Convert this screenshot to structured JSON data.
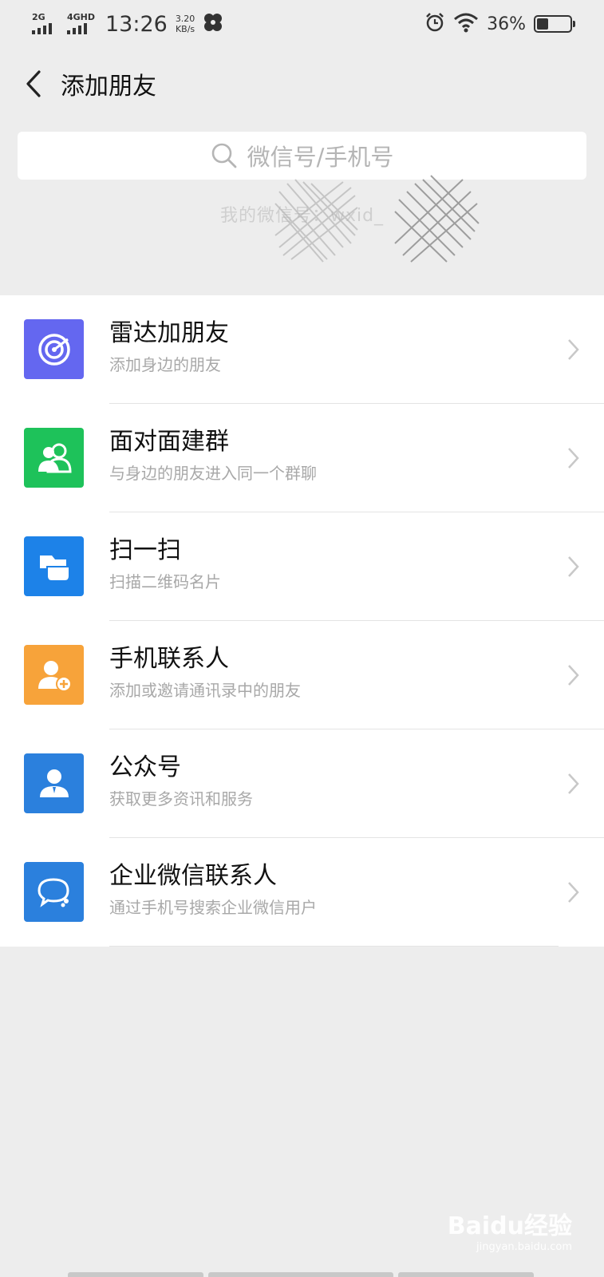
{
  "status_bar": {
    "net1": "2G",
    "net2": "4GHD",
    "time": "13:26",
    "speed_value": "3.20",
    "speed_unit": "KB/s",
    "battery_pct": "36%",
    "battery_level": 0.36
  },
  "header": {
    "title": "添加朋友"
  },
  "search": {
    "placeholder": "微信号/手机号"
  },
  "my_id": {
    "text": "我的微信号：wxid_"
  },
  "items": [
    {
      "title": "雷达加朋友",
      "subtitle": "添加身边的朋友",
      "icon": "radar-icon",
      "color": "#6467f0"
    },
    {
      "title": "面对面建群",
      "subtitle": "与身边的朋友进入同一个群聊",
      "icon": "group-icon",
      "color": "#1ec25a"
    },
    {
      "title": "扫一扫",
      "subtitle": "扫描二维码名片",
      "icon": "scan-icon",
      "color": "#1d82e8"
    },
    {
      "title": "手机联系人",
      "subtitle": "添加或邀请通讯录中的朋友",
      "icon": "add-contact-icon",
      "color": "#f7a33a"
    },
    {
      "title": "公众号",
      "subtitle": "获取更多资讯和服务",
      "icon": "official-account-icon",
      "color": "#2b80dd"
    },
    {
      "title": "企业微信联系人",
      "subtitle": "通过手机号搜索企业微信用户",
      "icon": "enterprise-chat-icon",
      "color": "#2b80dd"
    }
  ],
  "watermark": {
    "text": "Baidu经验",
    "sub": "jingyan.baidu.com"
  }
}
